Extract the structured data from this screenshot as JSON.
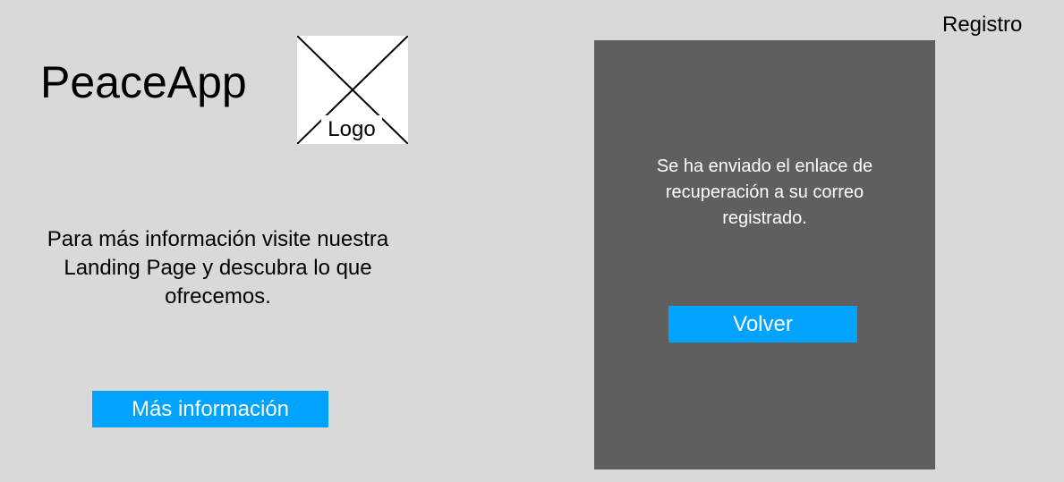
{
  "header": {
    "register_link": "Registro"
  },
  "brand": {
    "app_name": "PeaceApp",
    "logo_label": "Logo"
  },
  "info": {
    "text": "Para más información visite nuestra Landing Page y descubra lo que ofrecemos.",
    "more_button": "Más información"
  },
  "panel": {
    "message": "Se ha enviado el enlace de recuperación a su correo registrado.",
    "back_button": "Volver"
  },
  "colors": {
    "background": "#d9d9d9",
    "panel": "#5f5f5f",
    "button": "#00a3ff",
    "button_text": "#ffffff"
  },
  "icons": {
    "logo_placeholder": "image-placeholder-icon"
  }
}
